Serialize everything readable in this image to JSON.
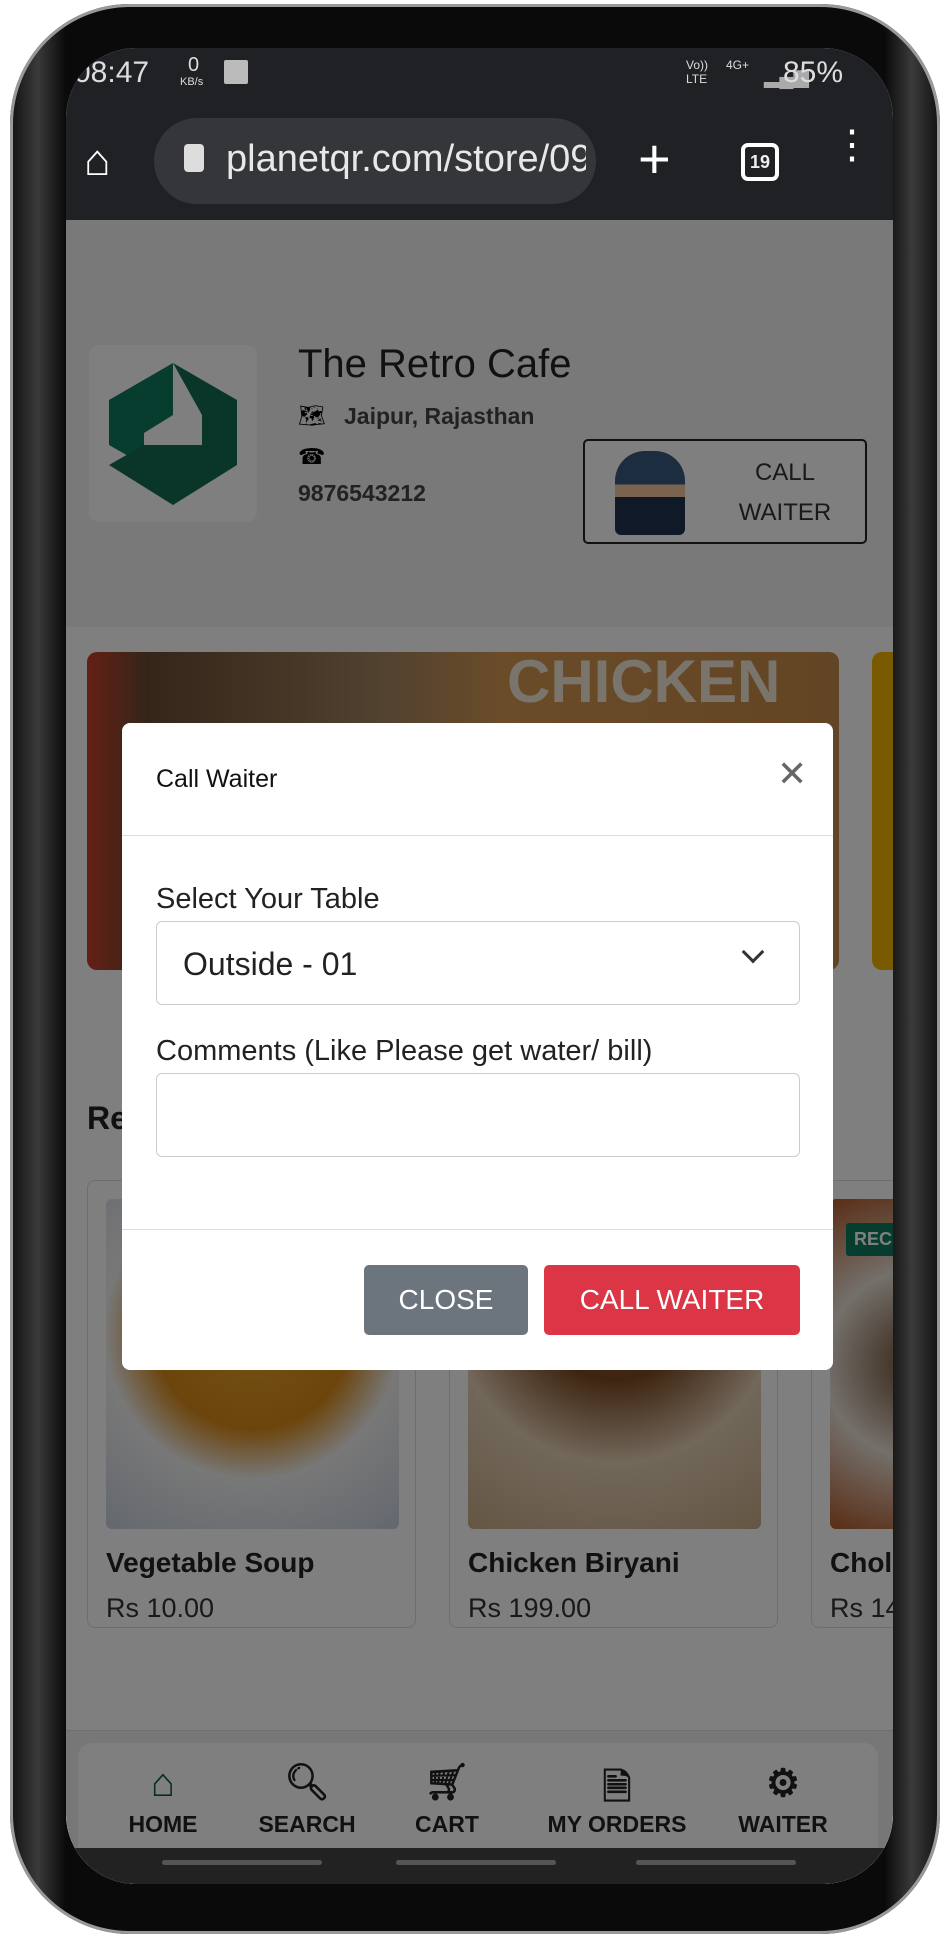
{
  "status_bar": {
    "time": "08:47",
    "net_speed": "0",
    "net_unit": "KB/s",
    "network": "Vo)) LTE",
    "network_type": "4G+",
    "battery": "85%"
  },
  "browser": {
    "url": "planetqr.com/store/09",
    "tab_count": "19"
  },
  "store": {
    "name": "The Retro Cafe",
    "location": "Jaipur, Rajasthan",
    "phone": "9876543212",
    "call_waiter_line1": "CALL",
    "call_waiter_line2": "WAITER",
    "banner_text": "CHICKEN",
    "brand_color": "#0f7a5f"
  },
  "section": {
    "title": "Re"
  },
  "products": [
    {
      "name": "Vegetable Soup",
      "price": "Rs 10.00"
    },
    {
      "name": "Chicken Biryani",
      "price": "Rs 199.00"
    },
    {
      "name": "Chol",
      "price": "Rs 14",
      "badge": "REC"
    }
  ],
  "modal": {
    "title": "Call Waiter",
    "table_label": "Select Your Table",
    "table_value": "Outside - 01",
    "comments_label": "Comments (Like Please get water/ bill)",
    "comments_value": "",
    "close_label": "CLOSE",
    "call_label": "CALL WAITER",
    "close_color": "#6c757d",
    "call_color": "#dc3545"
  },
  "nav": [
    {
      "label": "HOME",
      "icon": "home-icon"
    },
    {
      "label": "SEARCH",
      "icon": "search-icon"
    },
    {
      "label": "CART",
      "icon": "cart-icon"
    },
    {
      "label": "MY ORDERS",
      "icon": "document-icon"
    },
    {
      "label": "WAITER",
      "icon": "gear-icon"
    }
  ]
}
